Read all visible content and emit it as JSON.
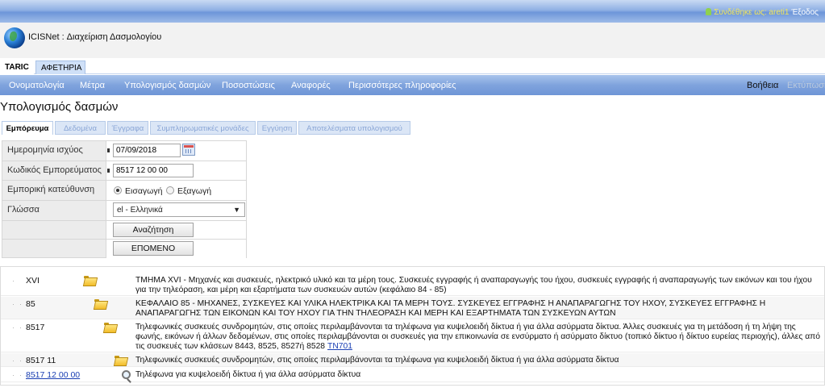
{
  "topbar": {
    "logged_in_label": "Συνδέθηκε ως: areti1",
    "exit_label": "Έξοδος"
  },
  "app": {
    "title": "ICISNet : Διαχείριση Δασμολογίου"
  },
  "module_tabs": [
    "TARIC",
    "ΑΦΕΤΗΡΙΑ"
  ],
  "menu": {
    "items": [
      "Ονοματολογία",
      "Μέτρα",
      "Υπολογισμός δασμών",
      "Ποσοστώσεις",
      "Αναφορές",
      "Περισσότερες πληροφορίες"
    ],
    "help": "Βοήθεια",
    "print": "Εκτύπωση"
  },
  "page_title": "Υπολογισμός δασμών",
  "sub_tabs": [
    "Εμπόρευμα",
    "Δεδομένα",
    "Έγγραφα",
    "Συμπληρωματικές μονάδες",
    "Εγγύηση",
    "Αποτελέσματα υπολογισμού"
  ],
  "form": {
    "date_label": "Ημερομηνία ισχύος",
    "date_value": "07/09/2018",
    "code_label": "Κωδικός Εμπορεύματος",
    "code_value": "8517 12 00 00",
    "direction_label": "Εμπορική κατεύθυνση",
    "import_label": "Εισαγωγή",
    "export_label": "Εξαγωγή",
    "language_label": "Γλώσσα",
    "language_value": "el - Ελληνικά",
    "search_button": "Αναζήτηση",
    "next_button": "ΕΠΟΜΕΝΟ"
  },
  "results": [
    {
      "code": "XVI",
      "icon": "folder-icon",
      "description": "ΤΜΗΜΑ XVI - Μηχανές και συσκευές, ηλεκτρικό υλικό και τα μέρη τους. Συσκευές εγγραφής ή αναπαραγωγής του ήχου, συσκευές εγγραφής ή αναπαραγωγής των εικόνων και του ήχου για την τηλεόραση, και μέρη και εξαρτήματα των συσκευών αυτών (κεφάλαιο 84 - 85)"
    },
    {
      "code": "85",
      "icon": "folder-icon",
      "description": "ΚΕΦΑΛΑΙΟ 85 - ΜΗΧΑΝΕΣ, ΣΥΣΚΕΥΕΣ ΚΑΙ ΥΛΙΚΑ ΗΛΕΚΤΡΙΚΑ ΚΑΙ ΤΑ ΜΕΡΗ ΤΟΥΣ. ΣΥΣΚΕΥΕΣ ΕΓΓΡΑΦΗΣ Η ΑΝΑΠΑΡΑΓΩΓΗΣ ΤΟΥ ΗΧΟΥ, ΣΥΣΚΕΥΕΣ ΕΓΓΡΑΦΗΣ Η ΑΝΑΠΑΡΑΓΩΓΗΣ ΤΩΝ ΕΙΚΟΝΩΝ ΚΑΙ ΤΟΥ ΗΧΟΥ ΓΙΑ ΤΗΝ ΤΗΛΕΟΡΑΣΗ ΚΑΙ ΜΕΡΗ ΚΑΙ ΕΞΑΡΤΗΜΑΤΑ ΤΩΝ ΣΥΣΚΕΥΩΝ ΑΥΤΩΝ"
    },
    {
      "code": "8517",
      "icon": "folder-icon",
      "description": "Τηλεφωνικές συσκευές συνδρομητών, στις οποίες περιλαμβάνονται τα τηλέφωνα για κυψελοειδή δίκτυα ή για άλλα ασύρματα δίκτυα. Άλλες συσκευές για τη μετάδοση ή τη λήψη της φωνής, εικόνων ή άλλων δεδομένων, στις οποίες περιλαμβάνονται οι συσκευές για την επικοινωνία σε ενσύρματο ή ασύρματο δίκτυο (τοπικό δίκτυο ή δίκτυο ευρείας περιοχής), άλλες από τις συσκευές των κλάσεων 8443, 8525, 8527ή 8528",
      "ref": "TN701"
    },
    {
      "code": "8517 11",
      "icon": "folder-icon",
      "description": "Τηλεφωνικές συσκευές συνδρομητών, στις οποίες περιλαμβάνονται τα τηλέφωνα για κυψελοειδή δίκτυα ή για άλλα ασύρματα δίκτυα"
    },
    {
      "code": "8517 12 00 00",
      "icon": "magnifier-icon",
      "description": "Τηλέφωνα για κυψελοειδή δίκτυα ή για άλλα ασύρματα δίκτυα"
    }
  ]
}
